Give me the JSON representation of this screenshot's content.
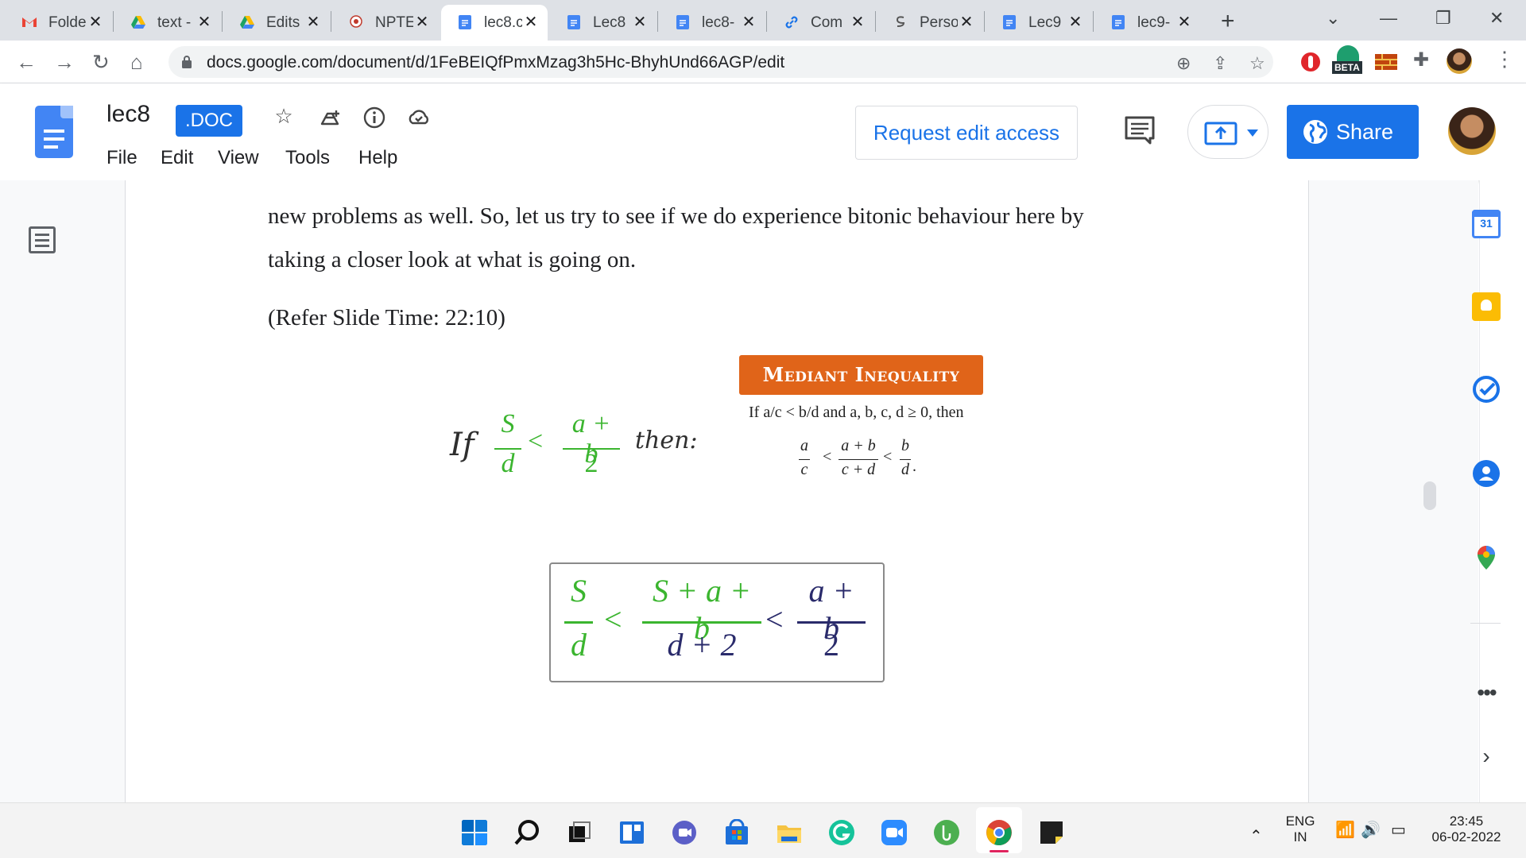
{
  "browser": {
    "tabs": [
      {
        "title": "Folde",
        "icon": "gmail-icon",
        "active": false
      },
      {
        "title": "text -",
        "icon": "drive-icon",
        "active": false
      },
      {
        "title": "Edits",
        "icon": "drive-icon",
        "active": false
      },
      {
        "title": "NPTE",
        "icon": "nptel-icon",
        "active": false
      },
      {
        "title": "lec8.c",
        "icon": "docs-icon",
        "active": true
      },
      {
        "title": "Lec8",
        "icon": "docs-icon",
        "active": false
      },
      {
        "title": "lec8-",
        "icon": "docs-icon",
        "active": false
      },
      {
        "title": "Com",
        "icon": "link-icon",
        "active": false
      },
      {
        "title": "Perso",
        "icon": "perso-icon",
        "active": false
      },
      {
        "title": "Lec9",
        "icon": "docs-icon",
        "active": false
      },
      {
        "title": "lec9-",
        "icon": "docs-icon",
        "active": false
      }
    ],
    "url": "docs.google.com/document/d/1FeBEIQfPmxMzag3h5Hc-BhyhUnd66AGP/edit",
    "ext_badge": "BETA"
  },
  "docs": {
    "title": "lec8",
    "badge": ".DOC",
    "menu": [
      "File",
      "Edit",
      "View",
      "Tools",
      "Help"
    ],
    "request_edit": "Request edit access",
    "share": "Share"
  },
  "document": {
    "line1": "new problems as well. So, let us try to see if we do experience bitonic behaviour here by",
    "line2": "taking a closer look at what is going on.",
    "refer": "(Refer Slide Time: 22:10)"
  },
  "slide": {
    "heading": "Mediant Inequality",
    "condition": "If a/c < b/d and a, b, c, d ≥ 0, then",
    "mediant": {
      "a": "a",
      "c": "c",
      "apb": "a + b",
      "cpd": "c + d",
      "b": "b",
      "d": "d",
      "lt": "<",
      "dot": "."
    },
    "hyp": {
      "if": "If",
      "S": "S",
      "d": "d",
      "lt": "<",
      "apb": "a + b",
      "two": "2",
      "then": "then:"
    },
    "result": {
      "S": "S",
      "d": "d",
      "lt1": "<",
      "num": "S + a + b",
      "den": "d + 2",
      "lt2": "<",
      "apb": "a + b",
      "two": "2"
    }
  },
  "sidepanel": {
    "calendar_day": "31"
  },
  "taskbar": {
    "lang": "ENG",
    "region": "IN",
    "time": "23:45",
    "date": "06-02-2022"
  },
  "colors": {
    "accent": "#1a73e8",
    "green_math": "#3bb52f",
    "navy_math": "#2a2b6b",
    "mediant_box": "#e06419"
  }
}
